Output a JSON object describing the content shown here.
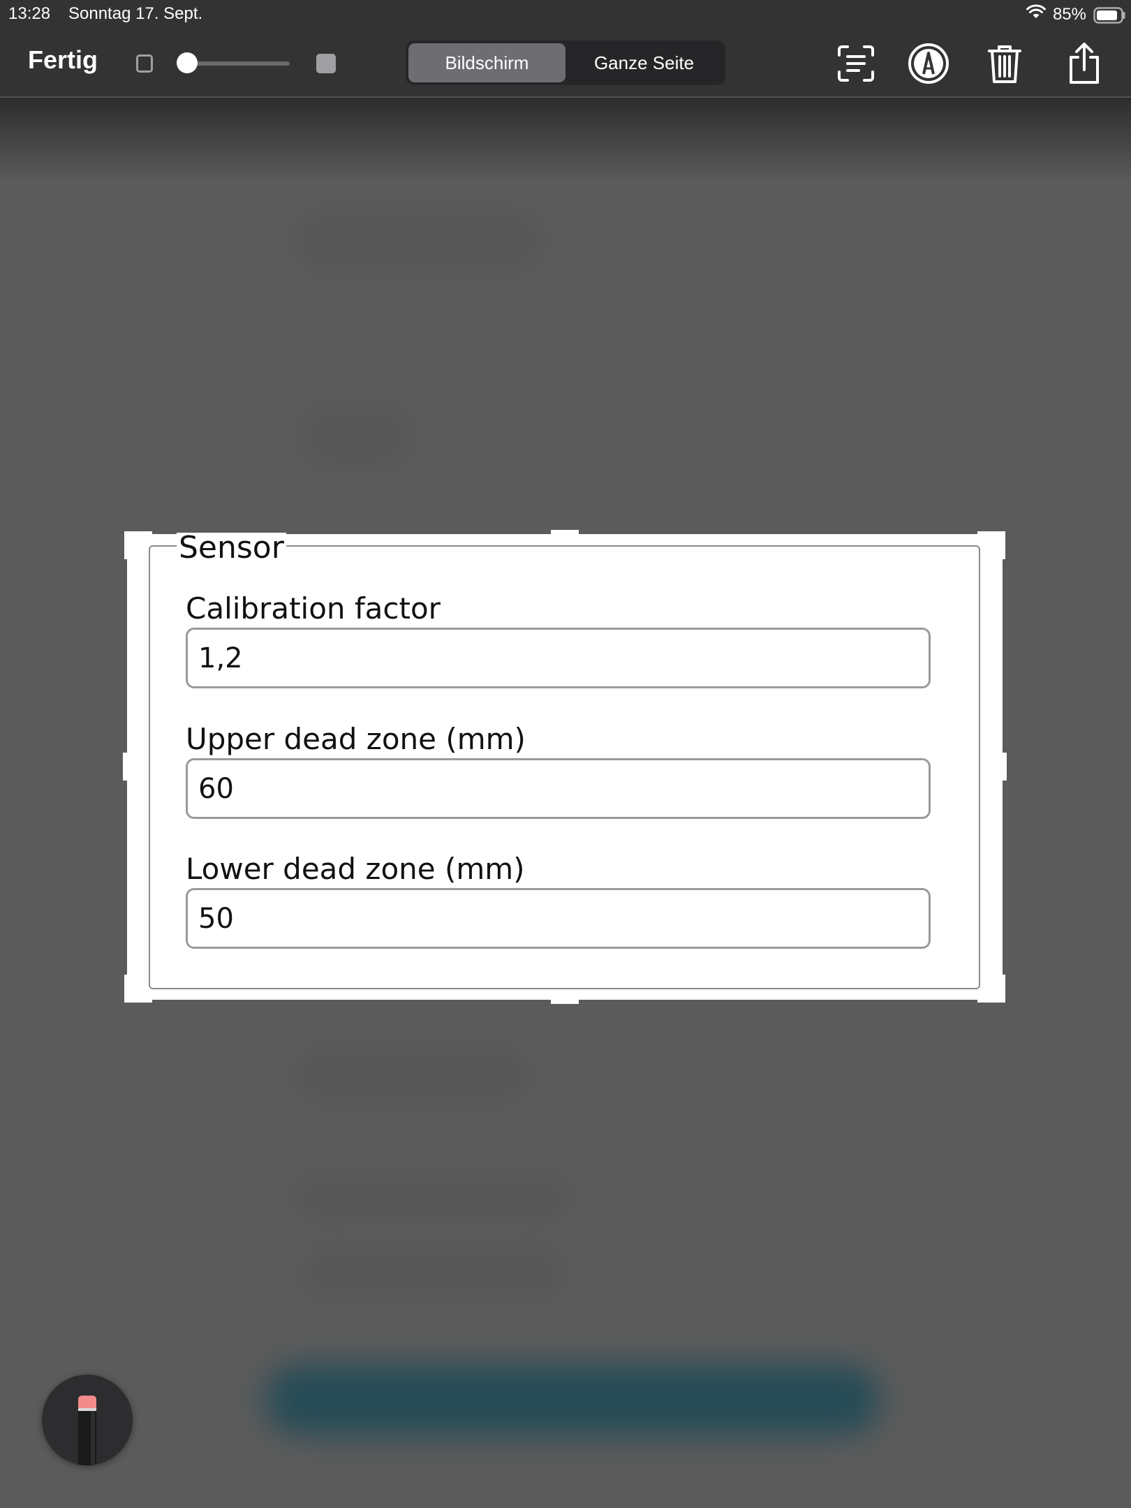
{
  "status_bar": {
    "time": "13:28",
    "date": "Sonntag 17. Sept.",
    "battery": "85%"
  },
  "toolbar": {
    "done_label": "Fertig",
    "segments": [
      "Bildschirm",
      "Ganze Seite"
    ],
    "active_segment": 0,
    "opacity_level": 0.0,
    "icons": [
      "text-recognition-icon",
      "markup-icon",
      "trash-icon",
      "share-icon"
    ]
  },
  "form": {
    "legend": "Sensor",
    "fields": [
      {
        "label": "Calibration factor",
        "value": "1,2"
      },
      {
        "label": "Upper dead zone (mm)",
        "value": "60"
      },
      {
        "label": "Lower dead zone (mm)",
        "value": "50"
      }
    ]
  },
  "colors": {
    "toolbar_bg": "#333334",
    "canvas_bg": "#5b5b5b",
    "segment_active": "#6d6d72",
    "pencil_tip": "#f28b8b"
  }
}
